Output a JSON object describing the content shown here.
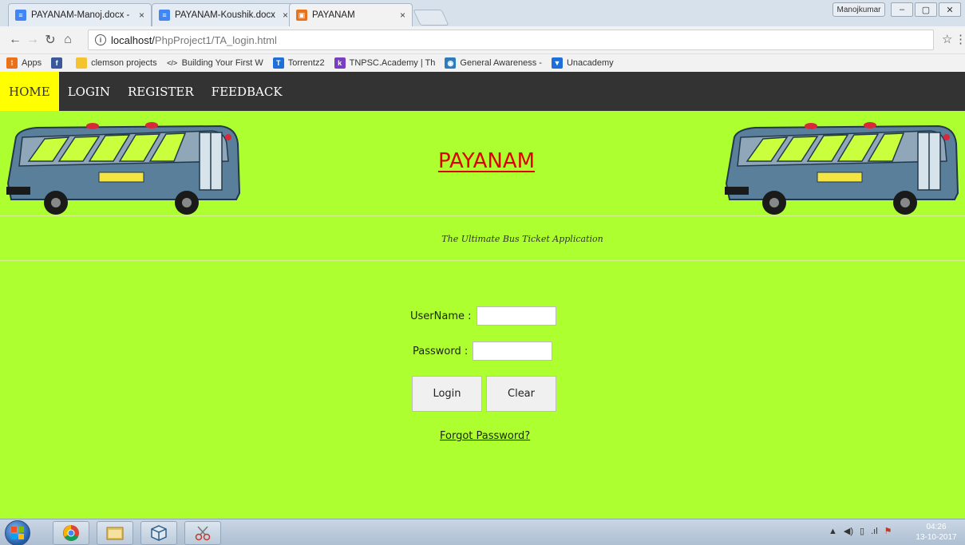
{
  "browser": {
    "tabs": [
      {
        "title": "PAYANAM-Manoj.docx -",
        "icon": "docs-icon",
        "color": "#4285f4"
      },
      {
        "title": "PAYANAM-Koushik.docx",
        "icon": "docs-icon",
        "color": "#4285f4"
      },
      {
        "title": "PAYANAM",
        "icon": "page-favicon",
        "color": "#e8711a"
      }
    ],
    "close_glyph": "×",
    "user": "Manojkumar",
    "window_controls": [
      "–",
      "▢",
      "✕"
    ],
    "url_host": "localhost/",
    "url_path": "PhpProject1/TA_login.html",
    "bookmarks": [
      {
        "label": "Apps",
        "icon": "apps-icon",
        "color": "#e8711a"
      },
      {
        "label": "",
        "icon": "facebook-icon",
        "color": "#3b5998"
      },
      {
        "label": "clemson projects",
        "icon": "folder-icon",
        "color": "#f4c430"
      },
      {
        "label": "Building Your First W",
        "icon": "code-icon",
        "color": "#777777"
      },
      {
        "label": "Torrentz2",
        "icon": "torrentz-icon",
        "color": "#1e6fd9"
      },
      {
        "label": "TNPSC.Academy | Th",
        "icon": "tnpsc-icon",
        "color": "#7a3fbf"
      },
      {
        "label": "General Awareness -",
        "icon": "owl-icon",
        "color": "#2f7bbf"
      },
      {
        "label": "Unacademy",
        "icon": "unacademy-icon",
        "color": "#1e6fd9"
      }
    ]
  },
  "nav": {
    "items": [
      "HOME",
      "LOGIN",
      "REGISTER",
      "FEEDBACK"
    ],
    "active": "HOME"
  },
  "header": {
    "title": "PAYANAM",
    "tagline": "The Ultimate Bus Ticket Application"
  },
  "form": {
    "username_label": "UserName :",
    "password_label": "Password :",
    "username_value": "",
    "password_value": "",
    "login_label": "Login",
    "clear_label": "Clear",
    "forgot_label": "Forgot Password?"
  },
  "taskbar": {
    "time": "04:26",
    "date": "13-10-2017"
  },
  "colors": {
    "page_bg": "#adff2f",
    "navbar": "#333333",
    "nav_active": "#ffff00",
    "title": "#e00000"
  }
}
